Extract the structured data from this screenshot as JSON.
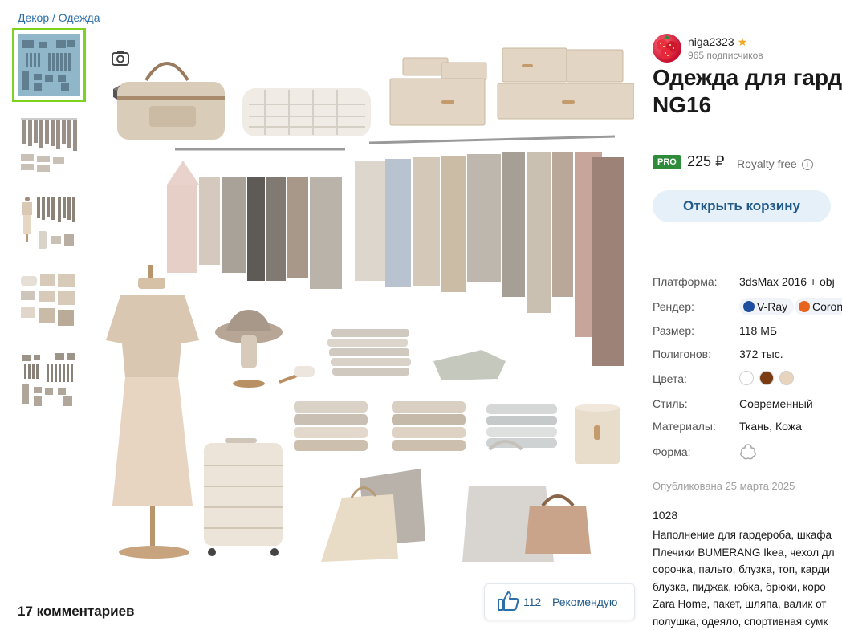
{
  "breadcrumb": {
    "parent": "Декор",
    "sep": " / ",
    "current": "Одежда"
  },
  "thumbnails": [
    "thumb-1",
    "thumb-2",
    "thumb-3",
    "thumb-4",
    "thumb-5"
  ],
  "tools": {
    "zoom_icon": "search-zoom-icon",
    "model_icon": "3d-cube-icon"
  },
  "author": {
    "name": "niga2323",
    "subscribers": "965 подписчиков"
  },
  "product": {
    "title": "Одежда для гард\nNG16",
    "pro_badge": "PRO",
    "price": "225 ₽",
    "license": "Royalty free",
    "cart_button": "Открыть корзину"
  },
  "specs": {
    "platform_label": "Платформа:",
    "platform": "3dsMax 2016 + obj",
    "render_label": "Рендер:",
    "render_vray": "V-Ray",
    "render_corona": "Coron",
    "size_label": "Размер:",
    "size": "118 МБ",
    "polygons_label": "Полигонов:",
    "polygons": "372 тыс.",
    "colors_label": "Цвета:",
    "style_label": "Стиль:",
    "style": "Современный",
    "materials_label": "Материалы:",
    "materials": "Ткань, Кожа",
    "form_label": "Форма:"
  },
  "colors": [
    "#ffffff",
    "#7a3a12",
    "#e8d3bd"
  ],
  "published": "Опубликована 25 марта 2025",
  "description": {
    "id": "1028",
    "lines": [
      "Наполнение для гардероба, шкафа",
      "Плечики BUMERANG Ikea, чехол дл",
      "сорочка, пальто, блузка, топ, карди",
      "блузка, пиджак, юбка, брюки, коро",
      "Zara Home, пакет, шляпа, валик от",
      "полушка, одеяло, спортивная сумк"
    ]
  },
  "comments": "17 комментариев",
  "likes": {
    "count": "112",
    "label": "Рекомендую"
  }
}
